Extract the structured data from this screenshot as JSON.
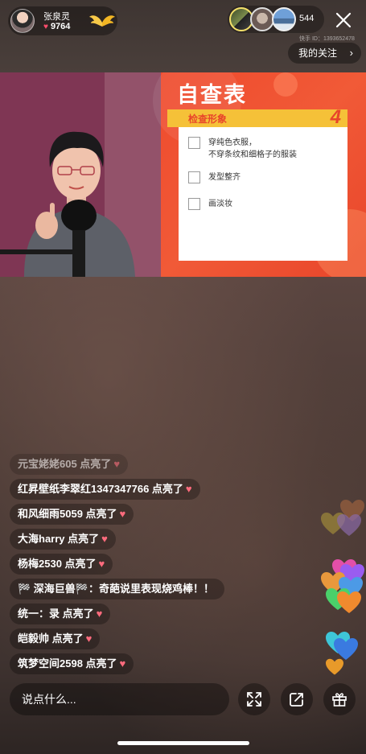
{
  "host": {
    "name": "张泉灵",
    "likes": "9764"
  },
  "viewers": {
    "count": "544"
  },
  "kwai_id": "快手 ID：1393652478",
  "follow_button": "我的关注",
  "slide": {
    "title": "自查表",
    "section": "检查形象",
    "number": "4",
    "items": [
      {
        "line1": "穿纯色衣服，",
        "line2": "不穿条纹和细格子的服装"
      },
      {
        "line1": "发型整齐",
        "line2": ""
      },
      {
        "line1": "画淡妆",
        "line2": ""
      }
    ]
  },
  "comments": [
    {
      "text": "元宝姥姥605 点亮了",
      "heart": "♥"
    },
    {
      "text": "红昇壁纸李翠红1347347766 点亮了",
      "heart": "♥"
    },
    {
      "text": "和风细雨5059 点亮了",
      "heart": "♥"
    },
    {
      "text": "大海harry 点亮了",
      "heart": "♥"
    },
    {
      "text": "杨梅2530 点亮了",
      "heart": "♥"
    },
    {
      "text": "🏁 深海巨兽🏁：奇葩说里表现烧鸡棒！！",
      "heart": ""
    },
    {
      "text": "统一：录 点亮了",
      "heart": "♥"
    },
    {
      "text": "皑毅帅 点亮了",
      "heart": "♥"
    },
    {
      "text": "筑梦空间2598 点亮了",
      "heart": "♥"
    }
  ],
  "input": {
    "placeholder": "说点什么..."
  },
  "icons": {
    "close": "close-icon",
    "expand": "expand-icon",
    "share": "share-icon",
    "gift": "gift-icon",
    "heart": "heart-icon"
  },
  "colors": {
    "heart": "#ff6b7d",
    "slide_red": "#ee4a2d",
    "slide_yellow": "#f5c138"
  }
}
